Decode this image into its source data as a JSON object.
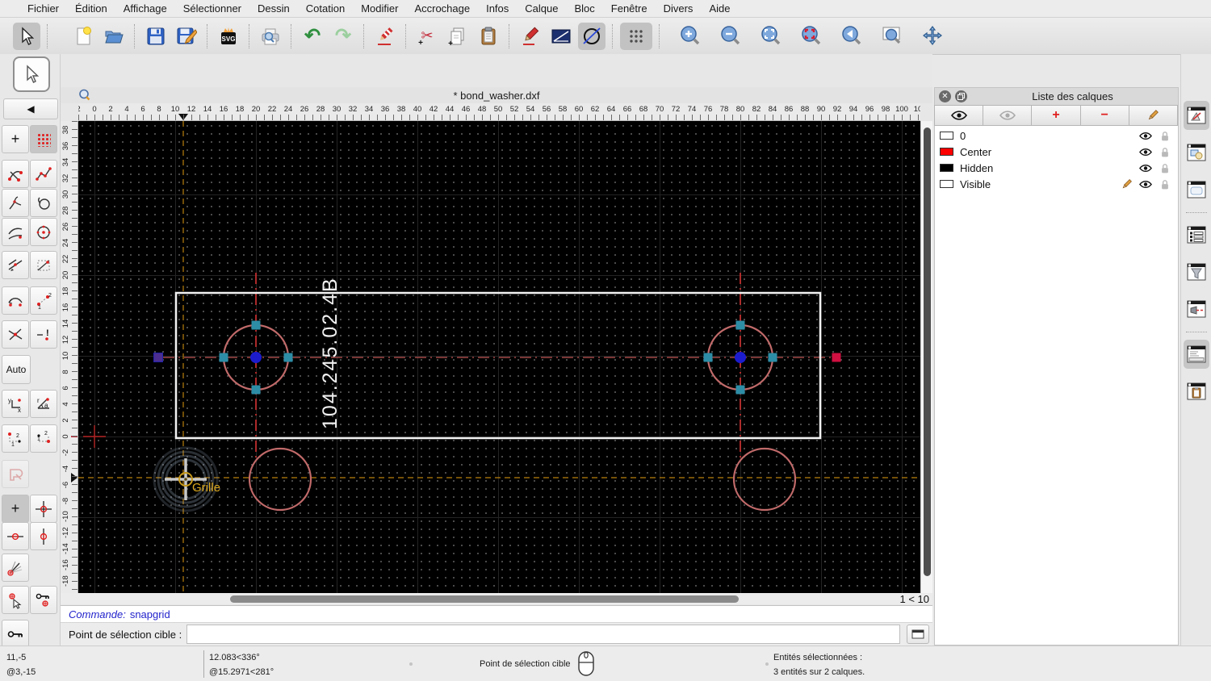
{
  "menu": {
    "items": [
      "Fichier",
      "Édition",
      "Affichage",
      "Sélectionner",
      "Dessin",
      "Cotation",
      "Modifier",
      "Accrochage",
      "Infos",
      "Calque",
      "Bloc",
      "Fenêtre",
      "Divers",
      "Aide"
    ]
  },
  "icons": {
    "undo": "↶",
    "redo": "↷",
    "cut": "✂",
    "back_arrow": "◀",
    "plus": "+",
    "minus": "−",
    "close": "✕"
  },
  "document": {
    "title": "* bond_washer.dxf",
    "zoom_indicator": "1 < 10"
  },
  "rulers": {
    "h_labels": [
      "2",
      "0",
      "2",
      "4",
      "6",
      "8",
      "10",
      "12",
      "14",
      "16",
      "18",
      "20",
      "22",
      "24",
      "26",
      "28",
      "30",
      "32",
      "34",
      "36",
      "38",
      "40",
      "42",
      "44",
      "46",
      "48",
      "50",
      "52",
      "54",
      "56",
      "58",
      "60",
      "62",
      "64",
      "66",
      "68",
      "70",
      "72",
      "74",
      "76",
      "78",
      "80",
      "82",
      "84",
      "86",
      "88",
      "90",
      "92",
      "94",
      "96",
      "98",
      "100",
      "10"
    ],
    "v_labels": [
      "38",
      "36",
      "34",
      "32",
      "30",
      "28",
      "26",
      "24",
      "22",
      "20",
      "18",
      "16",
      "14",
      "12",
      "10",
      "8",
      "6",
      "4",
      "2",
      "0",
      "-2",
      "-4",
      "-6",
      "-8",
      "-10",
      "-12",
      "-14",
      "-16",
      "-18"
    ]
  },
  "canvas": {
    "part_label": "104.245.02.4B",
    "snap_tooltip": "Grille"
  },
  "snap_palette": {
    "auto_label": "Auto",
    "coord_y": "y",
    "coord_x": "x",
    "coord_r": "r",
    "coord_a": "a"
  },
  "layers_panel": {
    "title": "Liste des calques",
    "layers": [
      {
        "name": "0",
        "swatch": "#ffffff",
        "current": false
      },
      {
        "name": "Center",
        "swatch": "#ff0000",
        "current": false
      },
      {
        "name": "Hidden",
        "swatch": "#000000",
        "current": false
      },
      {
        "name": "Visible",
        "swatch": "#ffffff",
        "current": true
      }
    ]
  },
  "command": {
    "history_label": "Commande:",
    "history_value": "snapgrid",
    "prompt_label": "Point de sélection cible :",
    "input_value": ""
  },
  "status": {
    "abs_coord": "11,-5",
    "rel_coord": "@3,-15",
    "abs_polar": "12.083<336°",
    "rel_polar": "@15.2971<281°",
    "hint": "Point de sélection cible",
    "selection_line1": "Entités sélectionnées :",
    "selection_line2": "3 entités sur 2 calques."
  },
  "colors": {
    "canvas_bg": "#000000",
    "entity_salmon": "#c16a6a",
    "centerline_red": "#e03232",
    "centerline_dim": "#a34848",
    "guide_orange": "#b97f0e",
    "handle_teal": "#2d8da6",
    "handle_blue": "#1c1ccd",
    "handle_purple": "#4b2e8f",
    "handle_crimson": "#d01040",
    "layer_red": "#ff0000",
    "command_blue": "#2222cc",
    "tooltip_yellow": "#dca81e"
  }
}
